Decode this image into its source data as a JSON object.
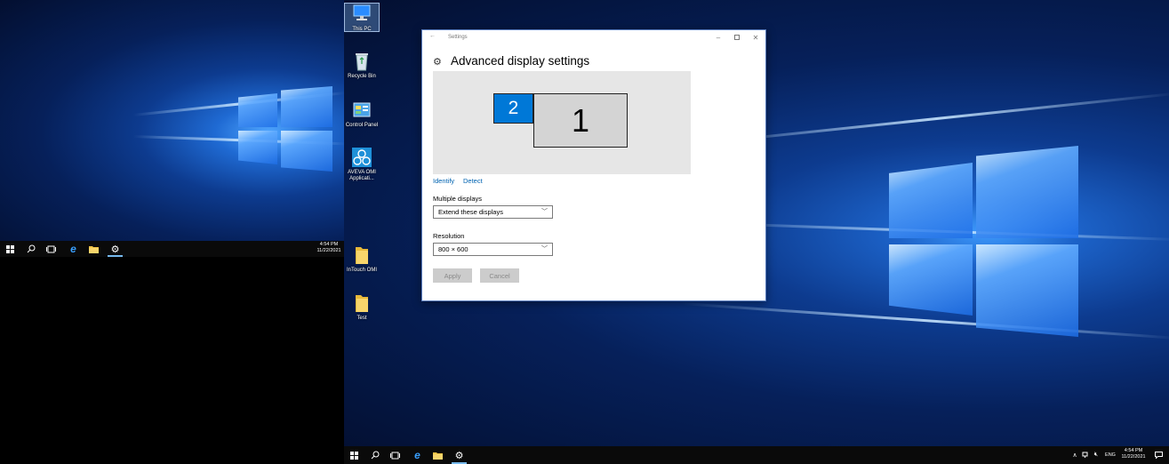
{
  "desktop_icons": [
    {
      "label": "This PC",
      "icon": "monitor-icon"
    },
    {
      "label": "Recycle Bin",
      "icon": "recycle-bin-icon"
    },
    {
      "label": "Control Panel",
      "icon": "control-panel-icon"
    },
    {
      "label": "AVEVA OMI Applicati...",
      "icon": "aveva-omi-icon"
    },
    {
      "label": "InTouch OMI",
      "icon": "folder-icon"
    },
    {
      "label": "Test",
      "icon": "folder-icon"
    }
  ],
  "left_taskbar": {
    "time": "4:54 PM",
    "date": "11/22/2021"
  },
  "main_taskbar": {
    "time": "4:54 PM",
    "date": "11/22/2021",
    "language": "ENG"
  },
  "settings_window": {
    "title": "Settings",
    "heading": "Advanced display settings",
    "monitor_1_label": "1",
    "monitor_2_label": "2",
    "identify_link": "Identify",
    "detect_link": "Detect",
    "multiple_displays_label": "Multiple displays",
    "multiple_displays_value": "Extend these displays",
    "resolution_label": "Resolution",
    "resolution_value": "800 × 600",
    "apply_button": "Apply",
    "cancel_button": "Cancel"
  },
  "colors": {
    "accent": "#0078d7",
    "link": "#0063b1",
    "taskbar": "#0a0a0a"
  }
}
